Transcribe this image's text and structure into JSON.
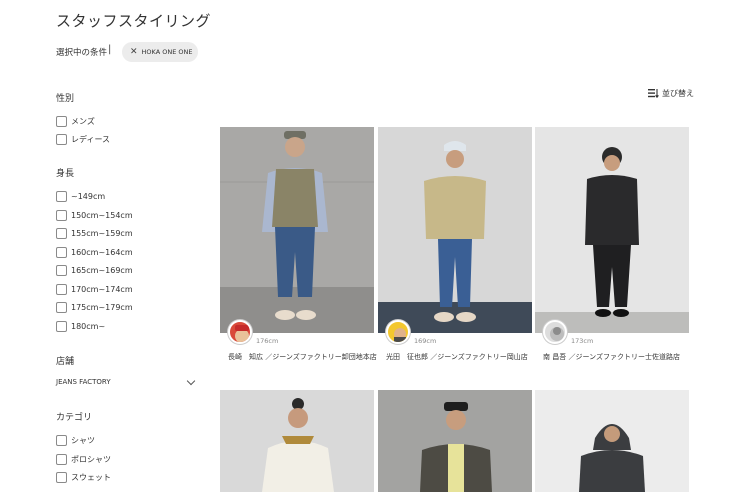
{
  "page": {
    "title": "スタッフスタイリング",
    "conditions_label": "選択中の条件",
    "separator": "|",
    "chip_label": "HOKA ONE ONE",
    "sort_label": "並び替え"
  },
  "filters": {
    "gender": {
      "title": "性別",
      "options": [
        "メンズ",
        "レディース"
      ]
    },
    "height": {
      "title": "身長",
      "options": [
        "~149cm",
        "150cm~154cm",
        "155cm~159cm",
        "160cm~164cm",
        "165cm~169cm",
        "170cm~174cm",
        "175cm~179cm",
        "180cm~"
      ]
    },
    "store": {
      "title": "店舗",
      "selected": "JEANS FACTORY"
    },
    "category": {
      "title": "カテゴリ",
      "options": [
        "シャツ",
        "ポロシャツ",
        "スウェット"
      ]
    }
  },
  "cards": [
    {
      "height": "176cm",
      "staff": "長崎　知広 ／ジーンズファクトリー卸団地本店"
    },
    {
      "height": "169cm",
      "staff": "光田　征也郎 ／ジーンズファクトリー岡山店"
    },
    {
      "height": "173cm",
      "staff": "南 昌吾 ／ジーンズファクトリー士佐道路店"
    }
  ],
  "colors": {
    "chip_bg": "#ececec",
    "photo_bg_1": "#a9a8a6",
    "photo_bg_2": "#d7d7d7",
    "photo_bg_3": "#e5e5e5"
  }
}
